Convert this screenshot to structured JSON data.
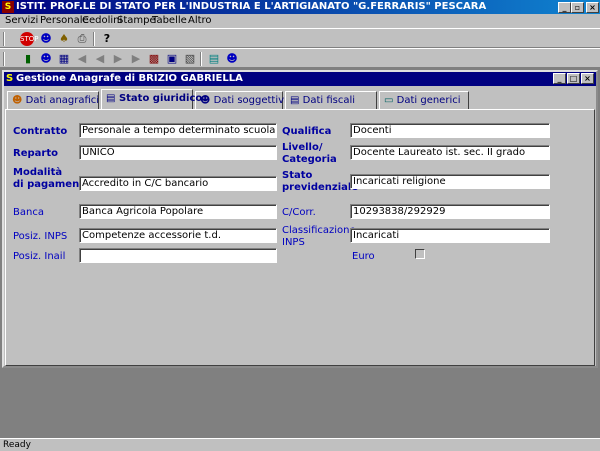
{
  "app": {
    "title": "ISTIT. PROF.LE DI STATO PER L'INDUSTRIA E L'ARTIGIANATO \"G.FERRARIS\" PESCARA",
    "minimize": "_",
    "restore": "▫",
    "close": "×"
  },
  "menu": [
    "Servizi",
    "Personale",
    "Cedolini",
    "Stampe",
    "Tabelle",
    "Altro"
  ],
  "child": {
    "title": "Gestione Anagrafe di BRIZIO GABRIELLA",
    "minimize": "_",
    "maximize": "□",
    "close": "×"
  },
  "tabs": [
    "Dati anagrafici",
    "Stato giuridico",
    "Dati soggettivi",
    "Dati fiscali",
    "Dati generici"
  ],
  "form": {
    "contratto_label": "Contratto",
    "contratto_value": "Personale a tempo determinato scuola",
    "qualifica_label": "Qualifica",
    "qualifica_value": "Docenti",
    "reparto_label": "Reparto",
    "reparto_value": "UNICO",
    "livello_label1": "Livello/",
    "livello_label2": "Categoria",
    "livello_value": "Docente Laureato ist. sec. II grado",
    "modalita_label1": "Modalità",
    "modalita_label2": "di pagamento",
    "modalita_value": "Accredito in C/C bancario",
    "stato_label1": "Stato",
    "stato_label2": "previdenziale",
    "stato_value": "Incaricati religione",
    "banca_label": "Banca",
    "banca_value": "Banca Agricola Popolare",
    "ccorr_label": "C/Corr.",
    "ccorr_value": "10293838/292929",
    "inps_label": "Posiz. INPS",
    "inps_value": "Competenze accessorie t.d.",
    "class_label1": "Classificazione",
    "class_label2": "INPS",
    "class_value": "Incaricati",
    "inail_label": "Posiz. Inail",
    "inail_value": "",
    "euro_label": "Euro"
  },
  "status": "Ready"
}
